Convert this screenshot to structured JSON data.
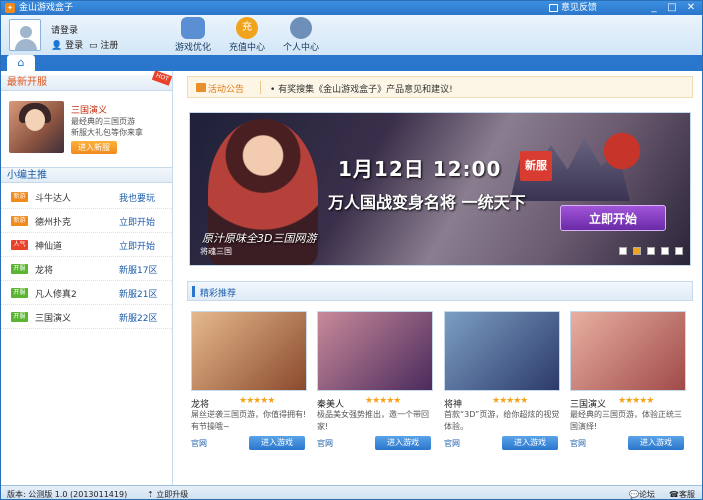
{
  "window": {
    "title": "金山游戏盒子",
    "feedback": "意见反馈",
    "minimize": "_",
    "maximize": "□",
    "close": "✕"
  },
  "header": {
    "login_prompt": "请登录",
    "login": "登录",
    "register": "注册",
    "nav": [
      {
        "label": "游戏优化",
        "icon": "gamepad-icon",
        "color": "#5b8fd4"
      },
      {
        "label": "充值中心",
        "icon": "recharge-icon",
        "color": "#f0a41c",
        "glyph": "充"
      },
      {
        "label": "个人中心",
        "icon": "user-center-icon",
        "color": "#6d8fb8"
      }
    ]
  },
  "tabs": {
    "home_icon": "⌂"
  },
  "sidebar": {
    "new_servers_title": "最新开服",
    "hot_badge": "HOT",
    "featured": {
      "title": "三国演义",
      "desc1": "最经典的三国页游",
      "desc2": "新服大礼包等你来拿",
      "button": "进入新服"
    },
    "editor_title": "小编主推",
    "items": [
      {
        "badge": "新游",
        "badge_color": "#f08a1c",
        "name": "斗牛达人",
        "action": "我也要玩"
      },
      {
        "badge": "新游",
        "badge_color": "#f08a1c",
        "name": "德州扑克",
        "action": "立即开始"
      },
      {
        "badge": "人气",
        "badge_color": "#e8422a",
        "name": "神仙道",
        "action": "立即开始"
      },
      {
        "badge": "开服",
        "badge_color": "#5cb531",
        "name": "龙将",
        "action": "新服17区"
      },
      {
        "badge": "开服",
        "badge_color": "#5cb531",
        "name": "凡人修真2",
        "action": "新服21区"
      },
      {
        "badge": "开服",
        "badge_color": "#5cb531",
        "name": "三国演义",
        "action": "新服22区"
      }
    ]
  },
  "main": {
    "notice_label": "活动公告",
    "notice_text": "• 有奖搜集《金山游戏盒子》产品意见和建议!",
    "banner": {
      "date": "1月12日  12:00",
      "new_tag": "新服",
      "slogan": "万人国战变身名将  一统天下",
      "start_button": "立即开始",
      "tagline": "原汁原味全3D三国网游",
      "caption": "将魂三国"
    },
    "recommend_title": "精彩推荐",
    "games": [
      {
        "name": "龙将",
        "stars": "★★★★★",
        "desc": "屌丝逆袭三国页游，你值得拥有!有节操哦~",
        "site": "官网",
        "enter": "进入游戏",
        "c1": "#e6b98d",
        "c2": "#8a4a2c"
      },
      {
        "name": "秦美人",
        "stars": "★★★★★",
        "desc": "极品美女强势推出，邀一个带回家!",
        "site": "官网",
        "enter": "进入游戏",
        "c1": "#c98a9a",
        "c2": "#4a2a5c"
      },
      {
        "name": "将神",
        "stars": "★★★★★",
        "desc": "首款“3D”页游，给你超炫的视觉体验。",
        "site": "官网",
        "enter": "进入游戏",
        "c1": "#7c9ec4",
        "c2": "#2c3a6a"
      },
      {
        "name": "三国演义",
        "stars": "★★★★★",
        "desc": "最经典的三国页游，体验正统三国演绎!",
        "site": "官网",
        "enter": "进入游戏",
        "c1": "#e8b0a0",
        "c2": "#a04a4a"
      }
    ]
  },
  "status": {
    "version": "版本: 公测版 1.0 (2013011419)",
    "upgrade": "立即升级",
    "forum": "论坛",
    "service": "客服"
  }
}
